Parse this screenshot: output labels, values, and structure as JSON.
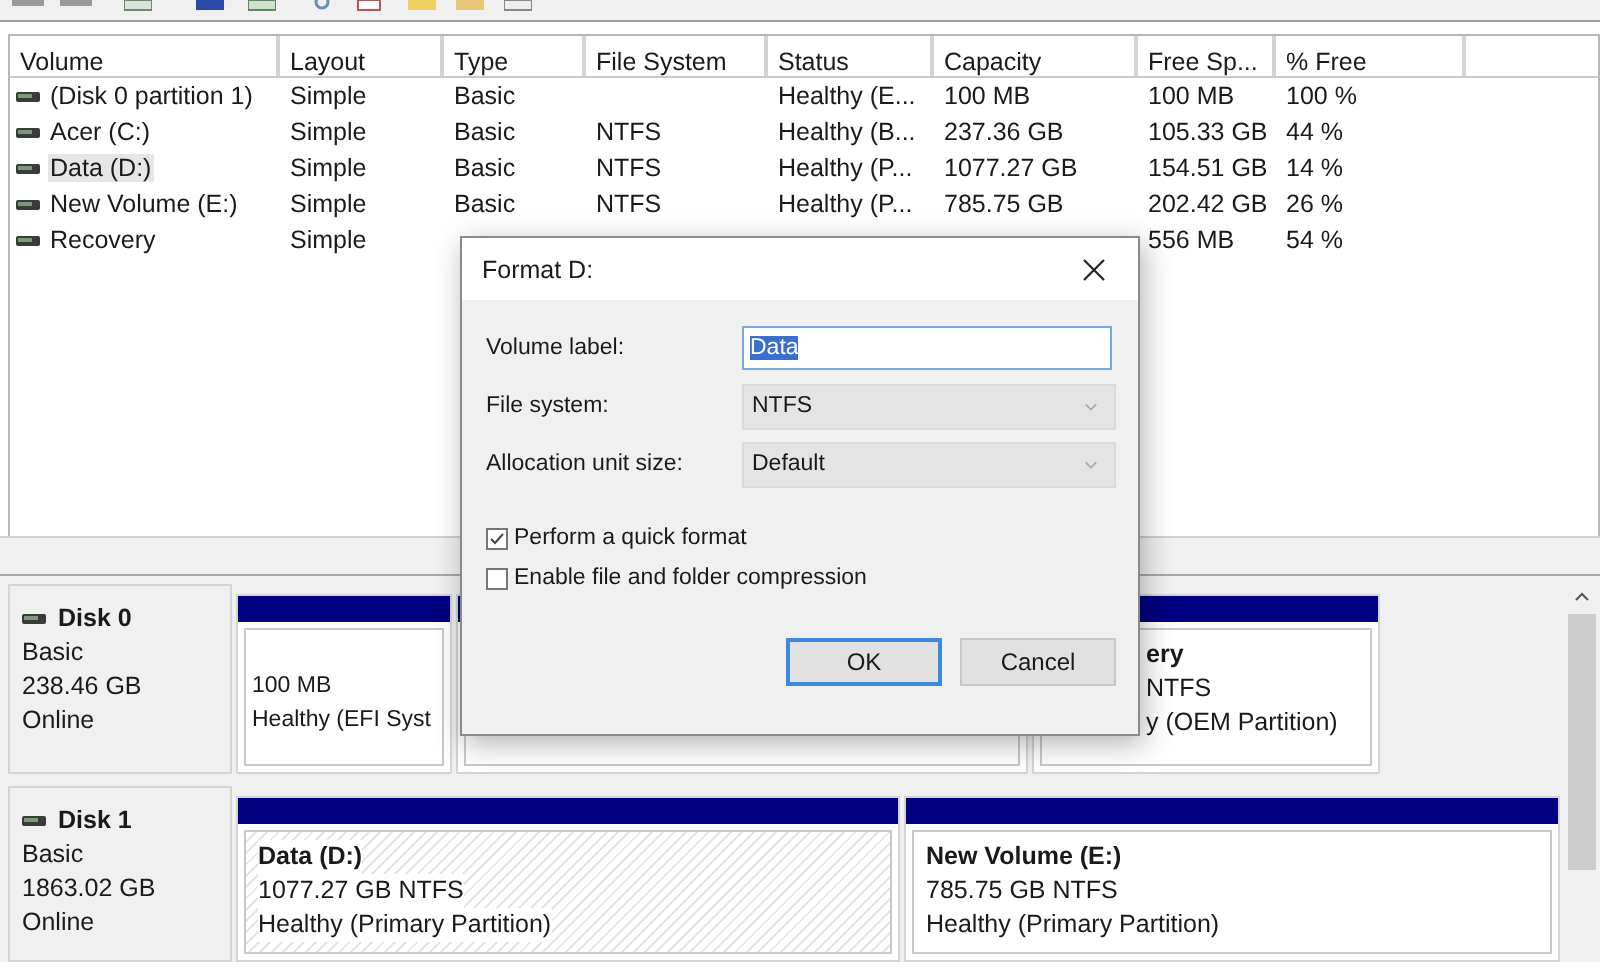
{
  "volume_list": {
    "columns": [
      "Volume",
      "Layout",
      "Type",
      "File System",
      "Status",
      "Capacity",
      "Free Sp...",
      "% Free"
    ],
    "rows": [
      {
        "volume": "(Disk 0 partition 1)",
        "layout": "Simple",
        "type": "Basic",
        "status": "Healthy (E...",
        "capacity": "100 MB",
        "free_space": "100 MB",
        "percent_free": "100 %",
        "selected": false
      },
      {
        "volume": "Acer (C:)",
        "layout": "Simple",
        "type": "Basic",
        "file_system": "NTFS",
        "status": "Healthy (B...",
        "capacity": "237.36 GB",
        "free_space": "105.33 GB",
        "percent_free": "44 %",
        "selected": false
      },
      {
        "volume": "Data (D:)",
        "layout": "Simple",
        "type": "Basic",
        "file_system": "NTFS",
        "status": "Healthy (P...",
        "capacity": "1077.27 GB",
        "free_space": "154.51 GB",
        "percent_free": "14 %",
        "selected": true
      },
      {
        "volume": "New Volume (E:)",
        "layout": "Simple",
        "type": "Basic",
        "file_system": "NTFS",
        "status": "Healthy (P...",
        "capacity": "785.75 GB",
        "free_space": "202.42 GB",
        "percent_free": "26 %",
        "selected": false
      },
      {
        "volume": "Recovery",
        "layout": "Simple",
        "free_space": "556 MB",
        "percent_free": "54 %",
        "selected": false
      }
    ]
  },
  "disks": [
    {
      "name": "Disk 0",
      "type": "Basic",
      "size": "238.46 GB",
      "status": "Online",
      "partitions": [
        {
          "kind": "plain",
          "size": "100 MB",
          "status": "Healthy (EFI Syst"
        },
        {
          "kind": "plain"
        },
        {
          "kind": "covered",
          "title": "ery",
          "size": "NTFS",
          "status": "y (OEM Partition)"
        }
      ]
    },
    {
      "name": "Disk 1",
      "type": "Basic",
      "size": "1863.02 GB",
      "status": "Online",
      "partitions": [
        {
          "kind": "hatched",
          "title": "Data  (D:)",
          "size": "1077.27 GB NTFS",
          "status": "Healthy (Primary Partition)"
        },
        {
          "kind": "plain",
          "title": "New Volume  (E:)",
          "size": "785.75 GB NTFS",
          "status": "Healthy (Primary Partition)"
        }
      ]
    }
  ],
  "dialog": {
    "title": "Format D:",
    "fields": [
      {
        "kind": "text",
        "label": "Volume label:",
        "value": "Data"
      },
      {
        "kind": "select",
        "label": "File system:",
        "value": "NTFS"
      },
      {
        "kind": "select",
        "label": "Allocation unit size:",
        "value": "Default"
      }
    ],
    "options": [
      {
        "label": "Perform a quick format",
        "checked": true
      },
      {
        "label": "Enable file and folder compression",
        "checked": false
      }
    ],
    "buttons": [
      {
        "label": "OK",
        "default": true
      },
      {
        "label": "Cancel",
        "default": false
      }
    ]
  }
}
